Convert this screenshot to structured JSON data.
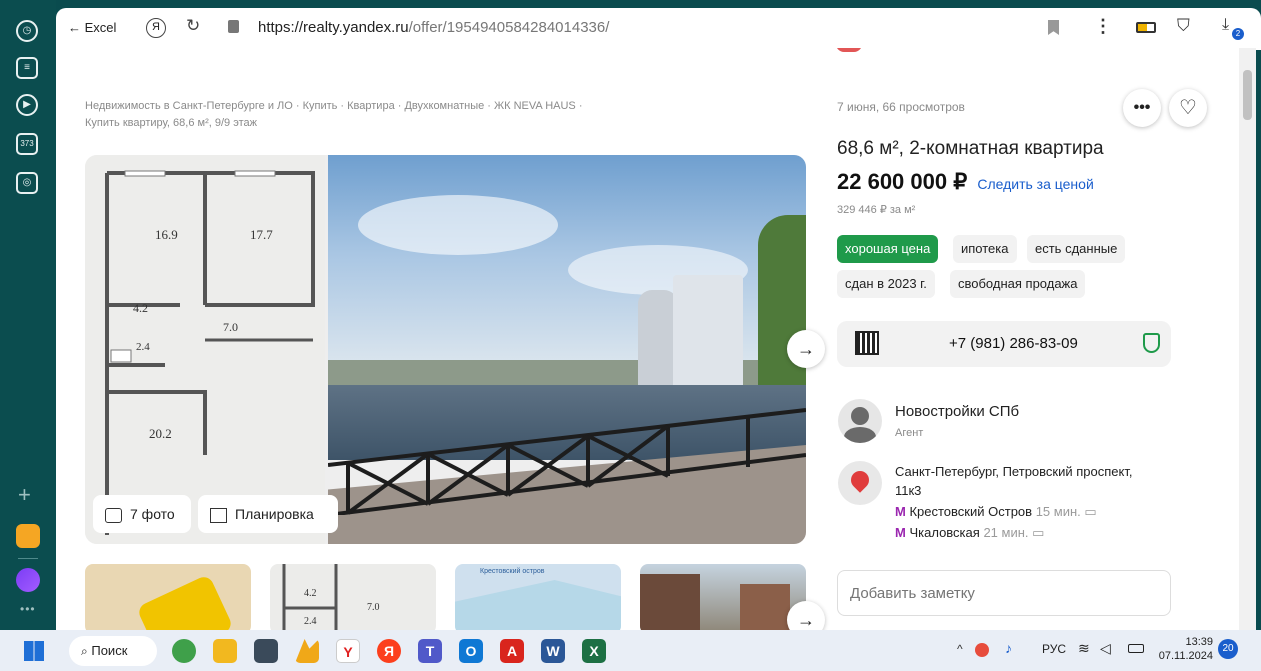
{
  "browser": {
    "back_label": "← Excel",
    "url_domain": "https://realty.yandex.ru",
    "url_path": "/offer/1954940584284014336/"
  },
  "sidebar": {
    "counter": "373"
  },
  "breadcrumbs": {
    "line1": "Недвижимость в Санкт-Петербурге и ЛО · Купить · Квартира · Двухкомнатные · ЖК NEVA HAUS ·",
    "line2": "Купить квартиру, 68,6 м², 9/9 этаж"
  },
  "plan": {
    "room1": "16.9",
    "room2": "17.7",
    "room3": "4.2",
    "room4": "7.0",
    "room5": "2.4",
    "room6": "20.2"
  },
  "thumb_plan": {
    "room1": "4.2",
    "room2": "7.0",
    "room3": "2.4"
  },
  "thumb_map": {
    "label": "Крестовский остров"
  },
  "gallery": {
    "photos_label": "7 фото",
    "plan_label": "Планировка"
  },
  "listing": {
    "meta": "7 июня, 66 просмотров",
    "title": "68,6 м², 2-комнатная квартира",
    "price": "22 600 000 ₽",
    "follow_price": "Следить за ценой",
    "price_per_m": "329 446 ₽ за м²",
    "tags": [
      "хорошая цена",
      "ипотека",
      "есть сданные",
      "сдан в 2023 г.",
      "свободная продажа"
    ],
    "phone": "+7 (981) 286-83-09"
  },
  "agent": {
    "name": "Новостройки СПб",
    "role": "Агент"
  },
  "address": {
    "line1": "Санкт-Петербург, Петровский проспект,",
    "line2": "11к3",
    "metro": [
      {
        "name": "Крестовский Остров",
        "time": "15 мин."
      },
      {
        "name": "Чкаловская",
        "time": "21 мин."
      }
    ]
  },
  "note": {
    "placeholder": "Добавить заметку"
  },
  "taskbar": {
    "search_label": "Поиск",
    "lang": "РУС",
    "time": "13:39",
    "date": "07.11.2024",
    "notif_count": "20",
    "download_count": "2"
  },
  "colors": {
    "accent_green": "#1f9a4a",
    "link_blue": "#1a5ecc",
    "metro_purple": "#9b27b0",
    "sidebar": "#0b4d4f"
  }
}
